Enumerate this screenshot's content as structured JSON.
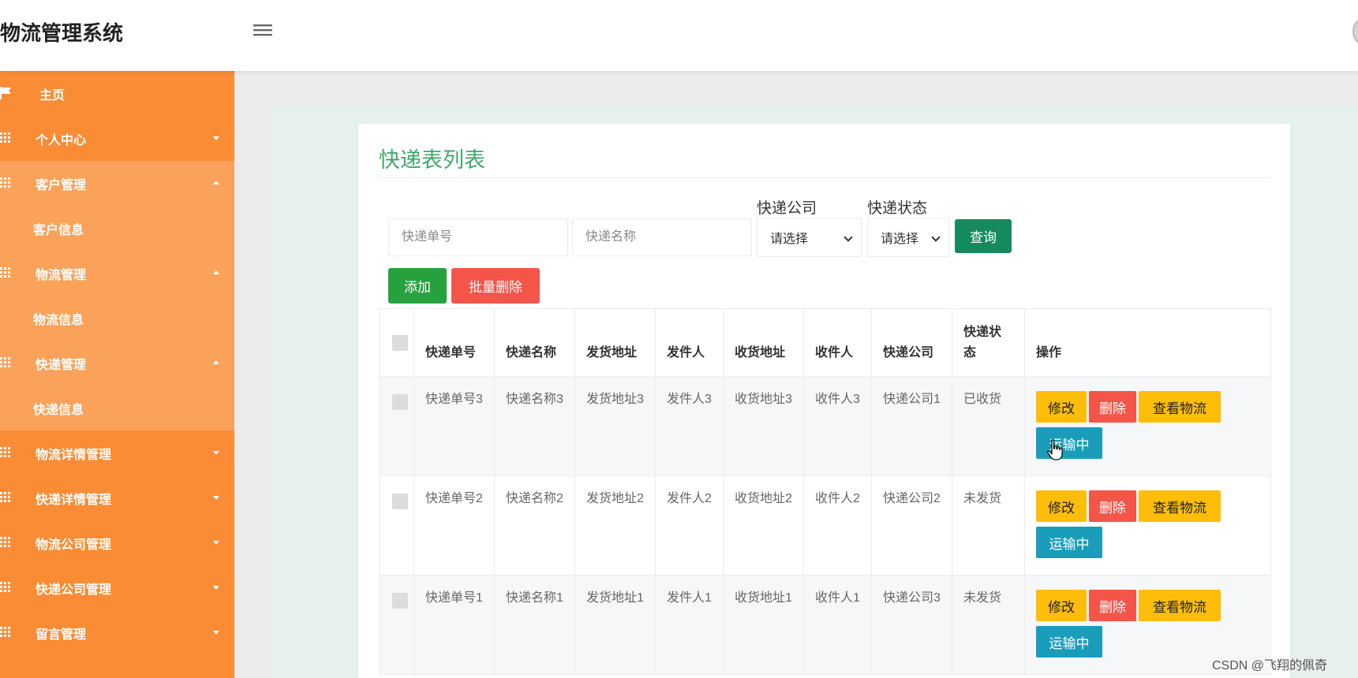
{
  "app": {
    "title": "物流管理系统"
  },
  "sidebar": {
    "items": [
      {
        "label": "主页",
        "icon": "flag-icon"
      },
      {
        "label": "个人中心",
        "icon": "grid-icon",
        "expanded": false
      },
      {
        "label": "客户管理",
        "icon": "grid-icon",
        "expanded": true
      },
      {
        "label": "客户信息",
        "sub": true
      },
      {
        "label": "物流管理",
        "icon": "grid-icon",
        "expanded": true
      },
      {
        "label": "物流信息",
        "sub": true
      },
      {
        "label": "快递管理",
        "icon": "grid-icon",
        "expanded": true
      },
      {
        "label": "快递信息",
        "sub": true
      },
      {
        "label": "物流详情管理",
        "icon": "grid-icon",
        "expanded": false
      },
      {
        "label": "快递详情管理",
        "icon": "grid-icon",
        "expanded": false
      },
      {
        "label": "物流公司管理",
        "icon": "grid-icon",
        "expanded": false
      },
      {
        "label": "快递公司管理",
        "icon": "grid-icon",
        "expanded": false
      },
      {
        "label": "留言管理",
        "icon": "grid-icon",
        "expanded": false
      }
    ]
  },
  "page": {
    "title": "快递表列表"
  },
  "search": {
    "number_placeholder": "快递单号",
    "name_placeholder": "快递名称",
    "company_label": "快递公司",
    "company_value": "请选择",
    "status_label": "快递状态",
    "status_value": "请选择",
    "query_label": "查询"
  },
  "toolbar": {
    "add_label": "添加",
    "batch_delete_label": "批量删除"
  },
  "table": {
    "headers": [
      "快递单号",
      "快递名称",
      "发货地址",
      "发件人",
      "收货地址",
      "收件人",
      "快递公司",
      "快递状态",
      "操作"
    ],
    "rows": [
      {
        "number": "快递单号3",
        "name": "快递名称3",
        "from": "发货地址3",
        "sender": "发件人3",
        "to": "收货地址3",
        "receiver": "收件人3",
        "company": "快递公司1",
        "status": "已收货"
      },
      {
        "number": "快递单号2",
        "name": "快递名称2",
        "from": "发货地址2",
        "sender": "发件人2",
        "to": "收货地址2",
        "receiver": "收件人2",
        "company": "快递公司2",
        "status": "未发货"
      },
      {
        "number": "快递单号1",
        "name": "快递名称1",
        "from": "发货地址1",
        "sender": "发件人1",
        "to": "收货地址1",
        "receiver": "收件人1",
        "company": "快递公司3",
        "status": "未发货"
      }
    ],
    "actions": {
      "edit": "修改",
      "delete": "删除",
      "track": "查看物流",
      "transit": "运输中"
    }
  },
  "watermark": "CSDN @飞翔的佩奇",
  "colors": {
    "sidebar": "#f98c35",
    "sidebar_active": "#faa25a",
    "title": "#3fa86b",
    "query": "#168a5f",
    "add": "#26a13e",
    "danger": "#f55449",
    "warning": "#fdbd09",
    "info": "#1a9dbb"
  }
}
